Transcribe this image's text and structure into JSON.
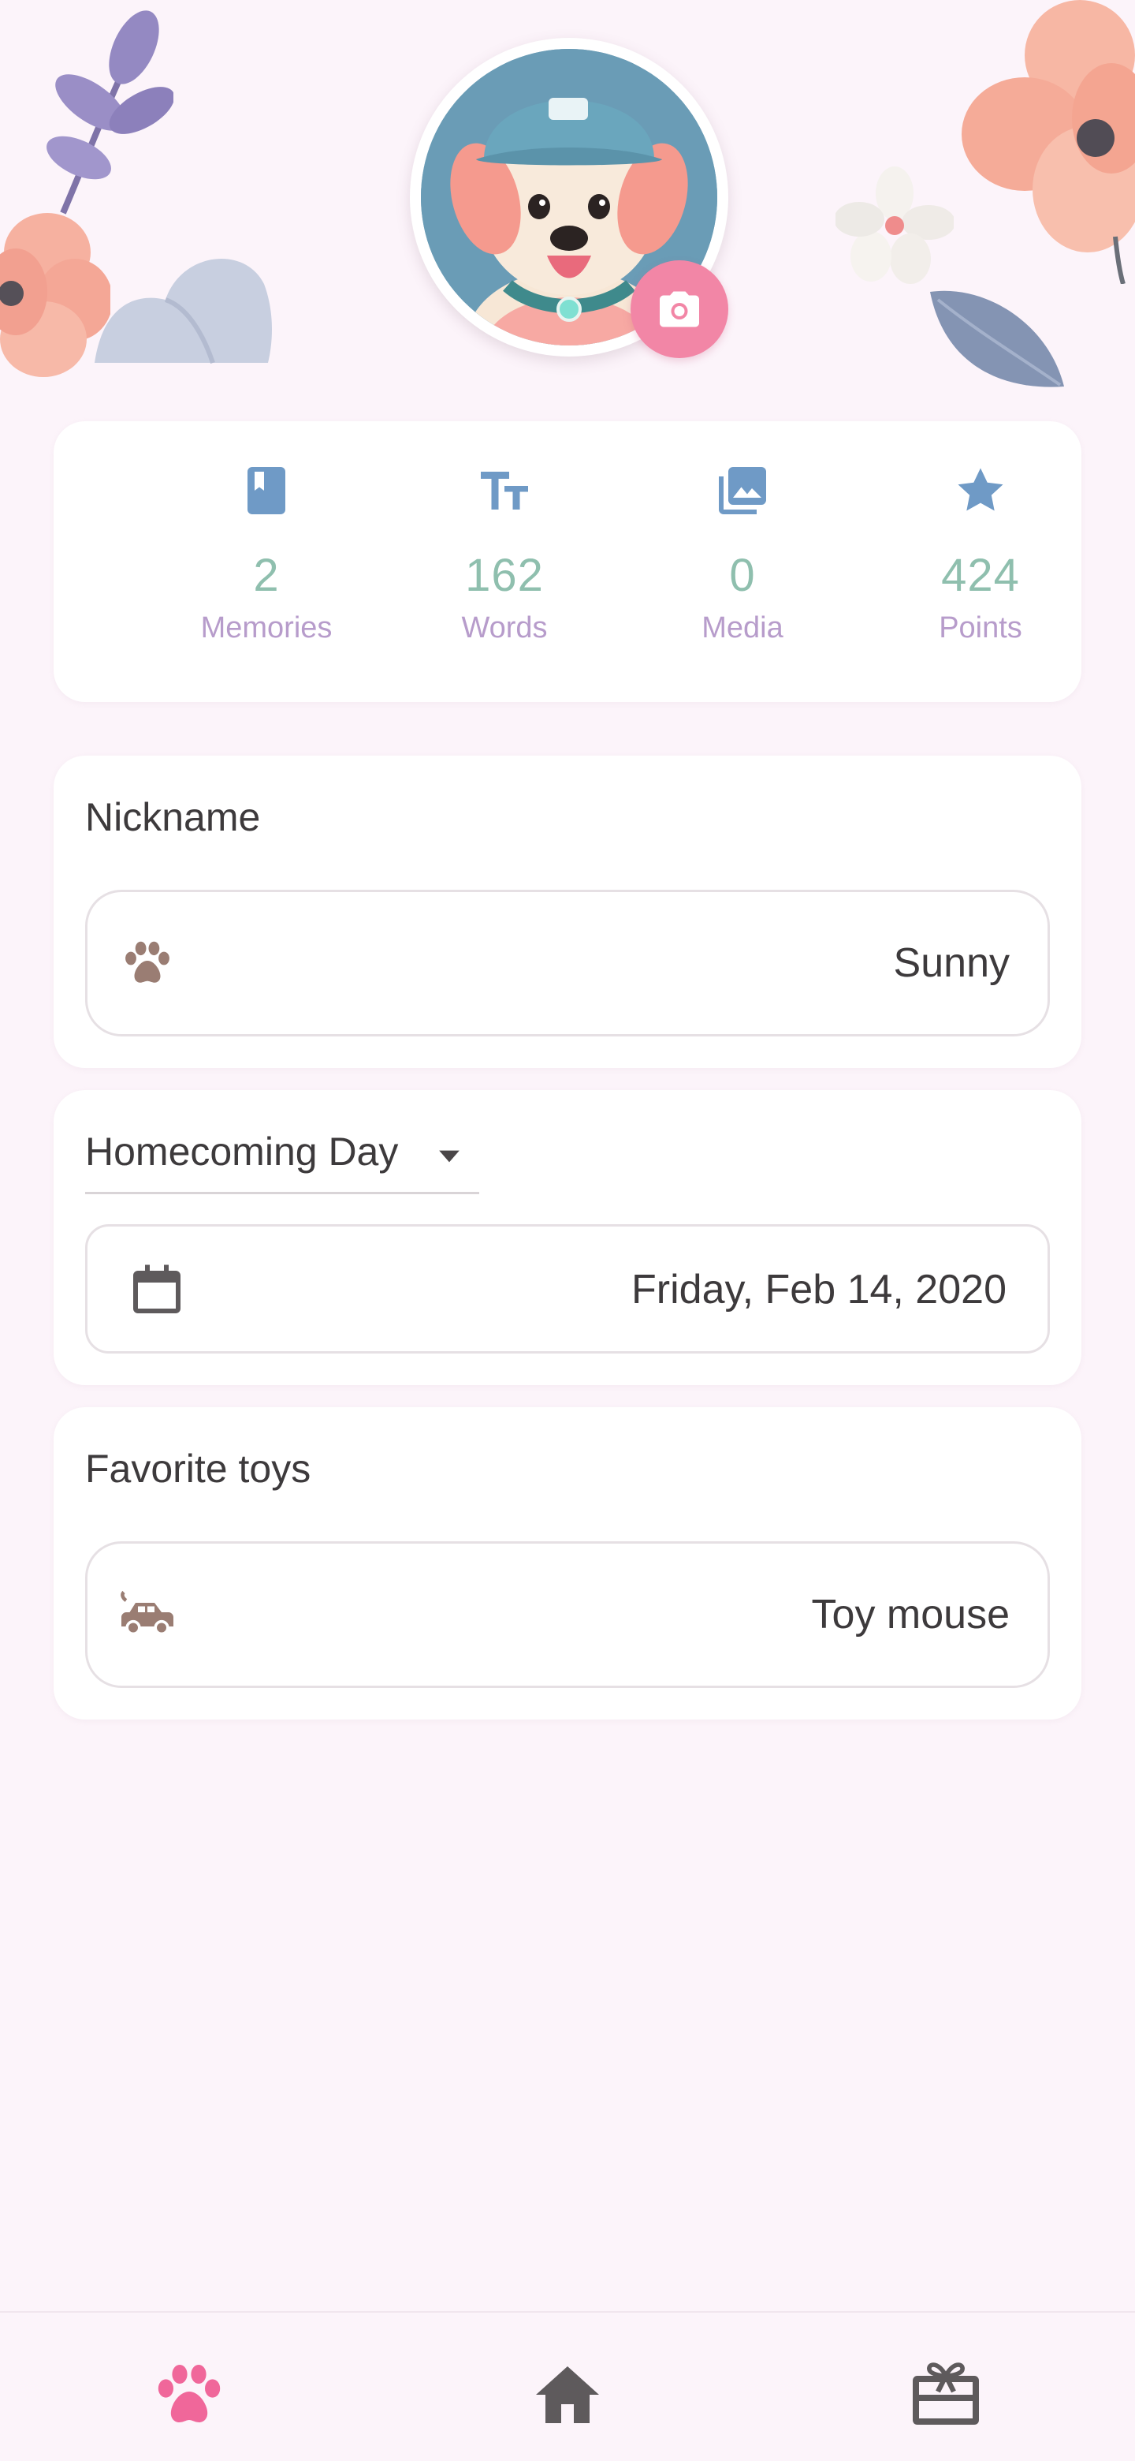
{
  "profile": {
    "avatar_icon": "dog-avatar",
    "camera_icon": "camera-icon"
  },
  "stats": [
    {
      "icon": "book-icon",
      "value": "2",
      "label": "Memories"
    },
    {
      "icon": "text-size-icon",
      "value": "162",
      "label": "Words"
    },
    {
      "icon": "photo-library-icon",
      "value": "0",
      "label": "Media"
    },
    {
      "icon": "star-icon",
      "value": "424",
      "label": "Points"
    }
  ],
  "nickname": {
    "title": "Nickname",
    "icon": "paw-icon",
    "value": "Sunny"
  },
  "homecoming": {
    "dropdown_label": "Homecoming Day",
    "icon": "calendar-icon",
    "value": "Friday, Feb 14, 2020"
  },
  "favorite_toys": {
    "title": "Favorite toys",
    "icon": "toy-car-icon",
    "value": "Toy mouse"
  },
  "bottom_nav": [
    {
      "icon": "paw-icon",
      "active": true
    },
    {
      "icon": "home-icon",
      "active": false
    },
    {
      "icon": "gift-card-icon",
      "active": false
    }
  ],
  "colors": {
    "background": "#fcf4fa",
    "stat_icon": "#6f9ac6",
    "stat_value": "#8fbfae",
    "stat_label": "#b79ccb",
    "field_icon": "#9a7d73",
    "accent_pink": "#f286a6",
    "nav_inactive": "#5e5a5c"
  }
}
